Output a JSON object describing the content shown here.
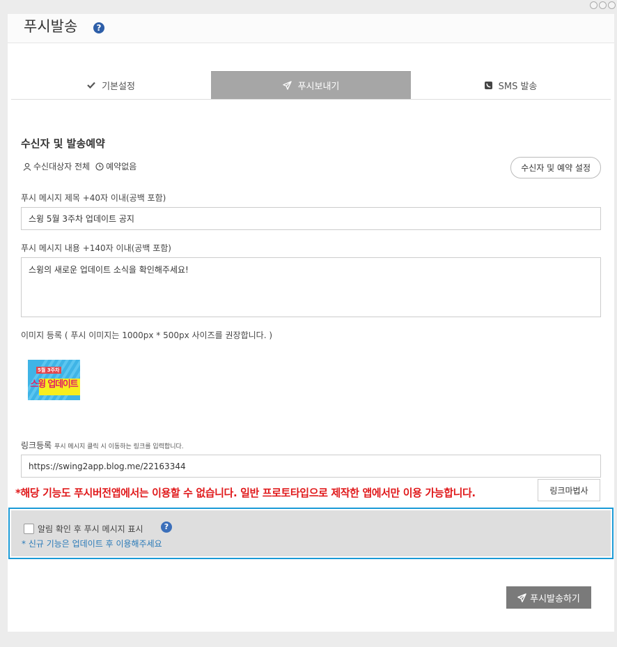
{
  "page": {
    "title": "푸시발송",
    "help_icon": "?"
  },
  "tabs": [
    {
      "label": "기본설정",
      "icon": "check-icon"
    },
    {
      "label": "푸시보내기",
      "icon": "paper-plane-icon",
      "active": true
    },
    {
      "label": "SMS 발송",
      "icon": "phone-icon"
    }
  ],
  "recipients": {
    "section_title": "수신자 및 발송예약",
    "target_label": "수신대상자 전체",
    "schedule_label": "예약없음",
    "settings_button": "수신자 및 예약 설정"
  },
  "form": {
    "title_label": "푸시 메시지 제목 +40자 이내(공백 포함)",
    "title_value": "스윙 5월 3주차 업데이트 공지",
    "body_label": "푸시 메시지 내용 +140자 이내(공백 포함)",
    "body_value": "스윙의 새로운 업데이트 소식을 확인해주세요!",
    "image_label": "이미지 등록 ( 푸시 이미지는 1000px * 500px 사이즈를 권장합니다. )",
    "image_text_top": "5월 3주차",
    "image_text_main": "스윙 업데이트",
    "link_label": "링크등록",
    "link_hint": "푸시 메시지 클릭 시 이동하는 링크를 입력합니다.",
    "link_value": "https://swing2app.blog.me/22163344",
    "link_copy_button": "링크마법사"
  },
  "warning": "*해당 기능도 푸시버전앱에서는 이용할 수 없습니다. 일반 프로토타입으로 제작한 앱에서만 이용 가능합니다.",
  "notice": {
    "checkbox_label": "알림 확인 후 푸시 메시지 표시",
    "help": "?",
    "note": "* 신규 기능은 업데이트 후 이용해주세요"
  },
  "send_button": "푸시발송하기",
  "colors": {
    "active_tab": "#a6a6a6",
    "warning": "#e0191b",
    "notice_border": "#1a9ad6",
    "note_text": "#2a7ab8",
    "send_button": "#7a7a7a"
  }
}
